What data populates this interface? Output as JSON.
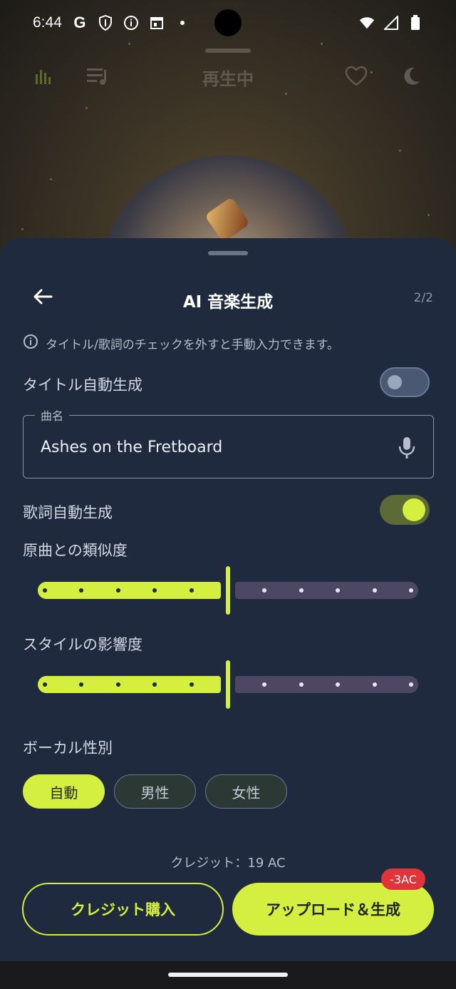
{
  "status_bar": {
    "time": "6:44",
    "left_icons": [
      "google-icon",
      "shield-icon",
      "info-circle-icon",
      "calendar-icon",
      "dot-icon"
    ],
    "right_icons": [
      "wifi-icon",
      "signal-icon",
      "battery-icon"
    ]
  },
  "player": {
    "title": "再生中",
    "left_icons": [
      "equalizer-icon",
      "queue-icon"
    ],
    "right_icons": [
      "heart-icon",
      "moon-icon"
    ]
  },
  "sheet": {
    "title": "AI 音楽生成",
    "page_indicator": "2/2",
    "info_text": "タイトル/歌詞のチェックを外すと手動入力できます。",
    "title_auto": {
      "label": "タイトル自動生成",
      "enabled": false
    },
    "song_name": {
      "label": "曲名",
      "value": "Ashes on the Fretboard"
    },
    "lyrics_auto": {
      "label": "歌詞自動生成",
      "enabled": true
    },
    "similarity": {
      "label": "原曲との類似度",
      "value": 0.5,
      "steps": 10
    },
    "style_influence": {
      "label": "スタイルの影響度",
      "value": 0.5,
      "steps": 10
    },
    "vocal_gender": {
      "label": "ボーカル性別",
      "options": [
        "自動",
        "男性",
        "女性"
      ],
      "selected": "自動"
    },
    "credit_text": "クレジット：19 AC",
    "buy_button": "クレジット購入",
    "generate_button": "アップロード＆生成",
    "cost_badge": "-3AC"
  },
  "colors": {
    "accent": "#d4ef3f",
    "sheet_bg": "#1f2a3f",
    "badge": "#e0343a",
    "slider_inactive": "#4c4762"
  }
}
